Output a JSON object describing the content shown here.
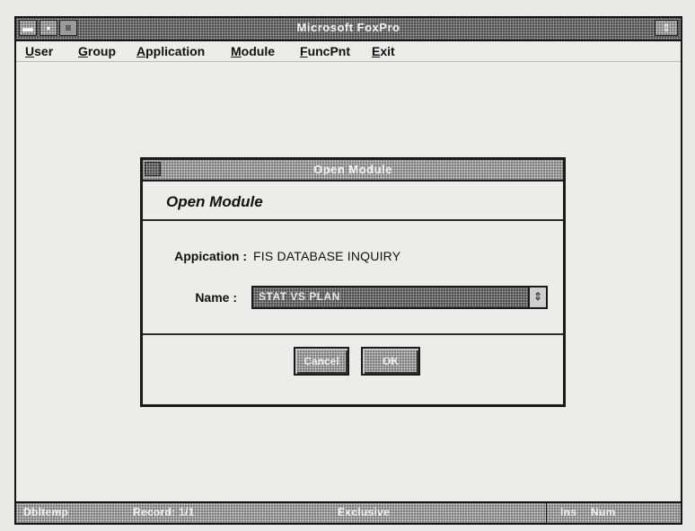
{
  "window": {
    "title": "Microsoft FoxPro",
    "control_menu_icon": "control-menu-icon",
    "restore_icon": "restore-icon"
  },
  "menu": [
    {
      "label": "User",
      "accel": "U",
      "rest": "ser"
    },
    {
      "label": "Group",
      "accel": "G",
      "rest": "roup"
    },
    {
      "label": "Application",
      "accel": "A",
      "rest": "pplication"
    },
    {
      "label": "Module",
      "accel": "M",
      "rest": "odule"
    },
    {
      "label": "FuncPnt",
      "accel": "F",
      "rest": "uncPnt"
    },
    {
      "label": "Exit",
      "accel": "E",
      "rest": "xit"
    }
  ],
  "dialog": {
    "title": "Open Module",
    "heading": "Open Module",
    "application_label": "Appication :",
    "application_value": "FIS DATABASE INQUIRY",
    "name_label": "Name :",
    "name_value": "STAT VS PLAN",
    "cancel_label": "Cancel",
    "ok_label": "OK"
  },
  "status": {
    "table": "Dbltemp",
    "record": "Record: 1/1",
    "mode": "Exclusive",
    "ins": "Ins",
    "num": "Num"
  },
  "colors": {
    "frame": "#151515",
    "background": "#ececea",
    "dither": "#7a7a7a"
  }
}
